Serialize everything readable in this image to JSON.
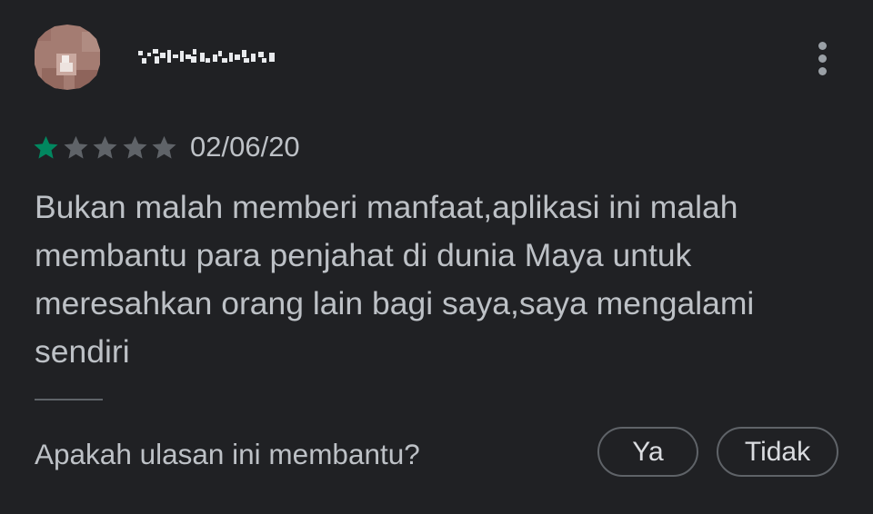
{
  "reviewer": {
    "name_obscured": true
  },
  "rating": {
    "stars_filled": 1,
    "stars_total": 5,
    "filled_color": "#01875f",
    "empty_color": "#5f6368"
  },
  "review": {
    "date": "02/06/20",
    "text": "Bukan malah memberi manfaat,aplikasi ini malah membantu para penjahat di dunia Maya untuk meresahkan orang lain bagi saya,saya mengalami sendiri"
  },
  "helpful": {
    "question": "Apakah ulasan ini membantu?",
    "yes_label": "Ya",
    "no_label": "Tidak"
  },
  "icons": {
    "menu": "more-vert-icon",
    "star": "star-icon",
    "avatar": "avatar-placeholder"
  }
}
